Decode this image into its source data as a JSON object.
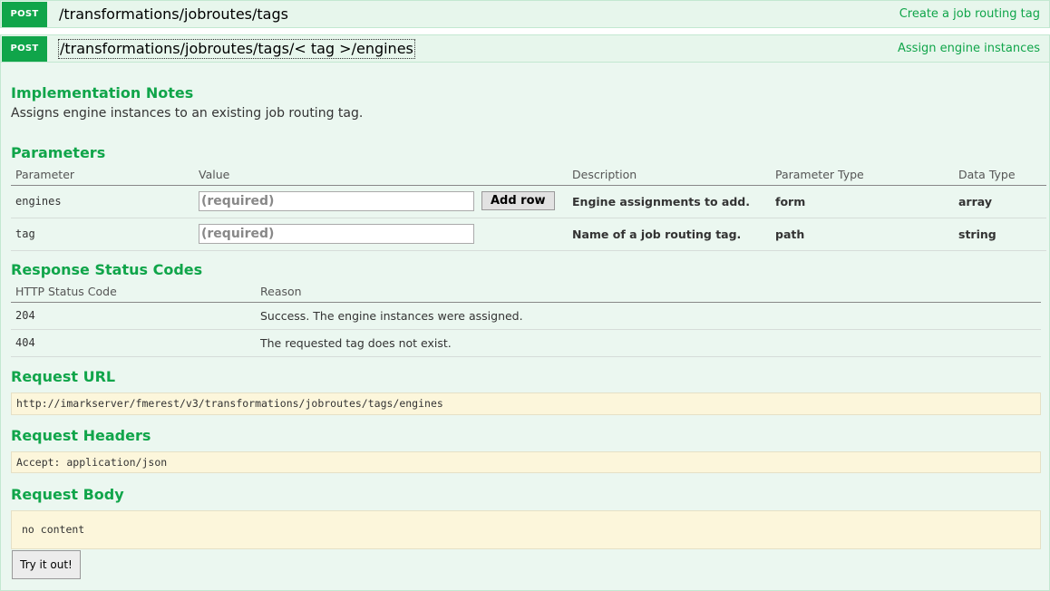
{
  "operations": [
    {
      "method": "POST",
      "path": "/transformations/jobroutes/tags",
      "summary": "Create a job routing tag"
    },
    {
      "method": "POST",
      "path": "/transformations/jobroutes/tags/< tag >/engines",
      "summary": "Assign engine instances"
    }
  ],
  "colors": {
    "accent": "#10a54a",
    "panel_bg": "#ebf7f0",
    "code_bg": "#fcf6db"
  },
  "implementation": {
    "title": "Implementation Notes",
    "text": "Assigns engine instances to an existing job routing tag."
  },
  "parameters": {
    "title": "Parameters",
    "headers": [
      "Parameter",
      "Value",
      "Description",
      "Parameter Type",
      "Data Type"
    ],
    "add_row_label": "Add row",
    "rows": [
      {
        "name": "engines",
        "placeholder": "(required)",
        "description": "Engine assignments to add.",
        "param_type": "form",
        "data_type": "array"
      },
      {
        "name": "tag",
        "placeholder": "(required)",
        "description": "Name of a job routing tag.",
        "param_type": "path",
        "data_type": "string"
      }
    ]
  },
  "responses": {
    "title": "Response Status Codes",
    "headers": [
      "HTTP Status Code",
      "Reason"
    ],
    "rows": [
      {
        "code": "204",
        "reason": "Success. The engine instances were assigned."
      },
      {
        "code": "404",
        "reason": "The requested tag does not exist."
      }
    ]
  },
  "request_url": {
    "title": "Request URL",
    "value": "http://imarkserver/fmerest/v3/transformations/jobroutes/tags/engines"
  },
  "request_headers": {
    "title": "Request Headers",
    "value": "Accept: application/json"
  },
  "request_body": {
    "title": "Request Body",
    "value": "no content"
  },
  "try_label": "Try it out!"
}
